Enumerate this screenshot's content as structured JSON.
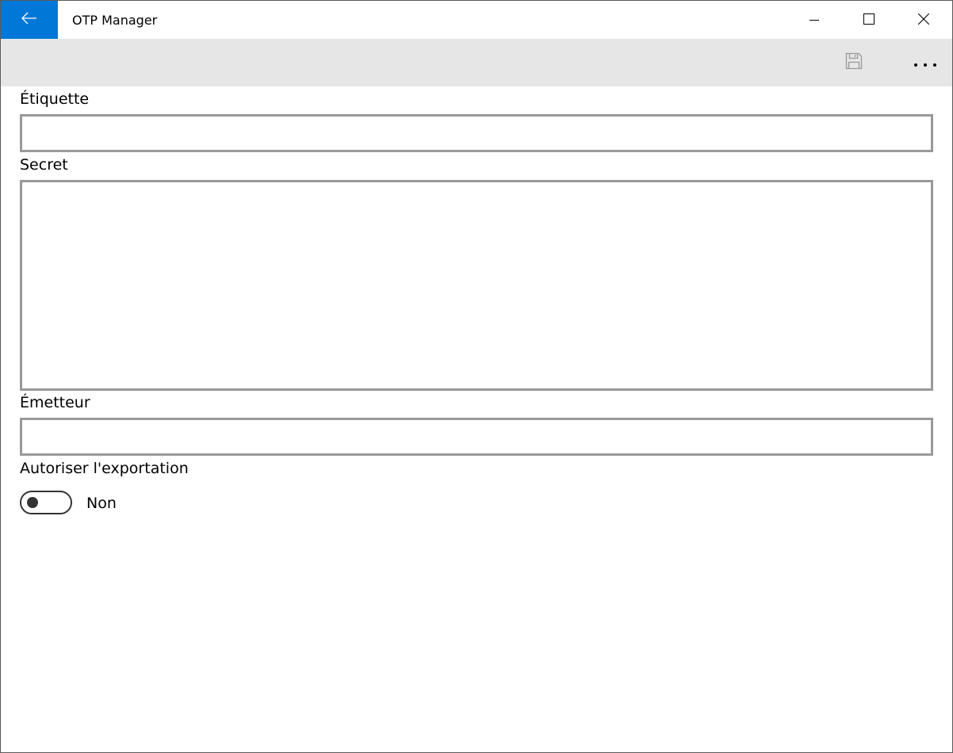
{
  "window": {
    "title": "OTP Manager",
    "accent_color": "#0078d7",
    "icons": {
      "back": "arrow-left-icon",
      "minimize": "minimize-icon",
      "maximize": "maximize-icon",
      "close": "close-icon"
    }
  },
  "command_bar": {
    "background": "#e6e6e6",
    "icons": {
      "save": "save-icon",
      "more": "more-ellipsis-icon"
    }
  },
  "form": {
    "label_field": {
      "label": "Étiquette",
      "value": ""
    },
    "secret_field": {
      "label": "Secret",
      "value": ""
    },
    "issuer_field": {
      "label": "Émetteur",
      "value": ""
    },
    "export_toggle": {
      "label": "Autoriser l'exportation",
      "state_text": "Non",
      "is_on": false
    }
  }
}
